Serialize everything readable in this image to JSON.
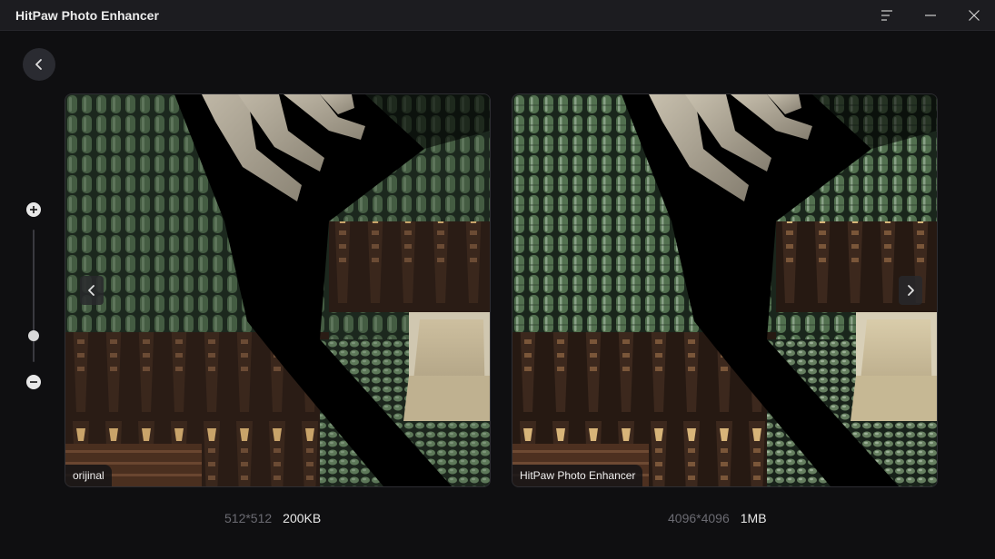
{
  "app": {
    "title": "HitPaw Photo Enhancer"
  },
  "panels": {
    "original": {
      "label": "orijinal",
      "resolution": "512*512",
      "size": "200KB"
    },
    "enhanced": {
      "label": "HitPaw Photo Enhancer",
      "resolution": "4096*4096",
      "size": "1MB"
    }
  },
  "zoom": {
    "level": 0.2
  },
  "icons": {
    "back": "chevron-left-icon",
    "menu": "menu-icon",
    "minimize": "minimize-icon",
    "close": "close-icon",
    "zoom_in": "plus-circle-icon",
    "zoom_out": "minus-circle-icon"
  },
  "colors": {
    "background": "#0f0f11",
    "titlebar": "#1c1c20",
    "tile_green": "#4e6b4c",
    "tile_dark": "#1c2a1e"
  }
}
